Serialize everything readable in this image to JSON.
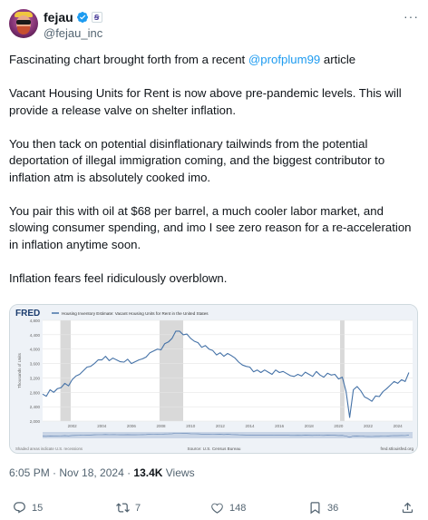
{
  "author": {
    "display_name": "fejau",
    "handle": "@fejau_inc",
    "affiliate_badge_glyph": "Ꞩ"
  },
  "more_label": "···",
  "text": {
    "p1_before": "Fascinating chart brought forth from a recent ",
    "p1_mention": "@profplum99",
    "p1_after": " article",
    "p2": "Vacant Housing Units for Rent is now above pre-pandemic levels. This will provide a release valve on shelter inflation.",
    "p3": "You then tack on potential disinflationary tailwinds from the potential deportation of illegal immigration coming, and the biggest contributor to inflation atm is absolutely cooked imo.",
    "p4": "You pair this with oil at $68 per barrel, a much cooler labor market, and slowing consumer spending, and imo I see zero reason for a re-acceleration in inflation anytime soon.",
    "p5": "Inflation fears feel ridiculously overblown."
  },
  "chart_data": {
    "type": "line",
    "source_logo": "FRED",
    "title": "Housing Inventory Estimate: Vacant Housing Units for Rent in the United States",
    "ylabel": "Thousands of Units",
    "ylim": [
      2000,
      4800
    ],
    "yticks": [
      "4,800",
      "4,400",
      "4,000",
      "3,600",
      "3,200",
      "2,800",
      "2,400",
      "2,000"
    ],
    "xlim": [
      2000,
      2025
    ],
    "xticks": [
      "2002",
      "2004",
      "2006",
      "2008",
      "2010",
      "2012",
      "2014",
      "2016",
      "2018",
      "2020",
      "2022",
      "2024"
    ],
    "recessions": [
      [
        2001.2,
        2001.9
      ],
      [
        2007.9,
        2009.5
      ],
      [
        2020.1,
        2020.4
      ]
    ],
    "footer_left": "Shaded areas indicate U.S. recessions",
    "source": "Source: U.S. Census Bureau",
    "url": "fred.stlouisfed.org",
    "series": [
      {
        "x": [
          2000.0,
          2000.25,
          2000.5,
          2000.75,
          2001.0,
          2001.25,
          2001.5,
          2001.75,
          2002.0,
          2002.25,
          2002.5,
          2002.75,
          2003.0,
          2003.25,
          2003.5,
          2003.75,
          2004.0,
          2004.25,
          2004.5,
          2004.75,
          2005.0,
          2005.25,
          2005.5,
          2005.75,
          2006.0,
          2006.25,
          2006.5,
          2006.75,
          2007.0,
          2007.25,
          2007.5,
          2007.75,
          2008.0,
          2008.25,
          2008.5,
          2008.75,
          2009.0,
          2009.25,
          2009.5,
          2009.75,
          2010.0,
          2010.25,
          2010.5,
          2010.75,
          2011.0,
          2011.25,
          2011.5,
          2011.75,
          2012.0,
          2012.25,
          2012.5,
          2012.75,
          2013.0,
          2013.25,
          2013.5,
          2013.75,
          2014.0,
          2014.25,
          2014.5,
          2014.75,
          2015.0,
          2015.25,
          2015.5,
          2015.75,
          2016.0,
          2016.25,
          2016.5,
          2016.75,
          2017.0,
          2017.25,
          2017.5,
          2017.75,
          2018.0,
          2018.25,
          2018.5,
          2018.75,
          2019.0,
          2019.25,
          2019.5,
          2019.75,
          2020.0,
          2020.25,
          2020.5,
          2020.75,
          2021.0,
          2021.25,
          2021.5,
          2021.75,
          2022.0,
          2022.25,
          2022.5,
          2022.75,
          2023.0,
          2023.25,
          2023.5,
          2023.75,
          2024.0,
          2024.25,
          2024.5,
          2024.75
        ],
        "y": [
          2750,
          2690,
          2870,
          2800,
          2900,
          2930,
          3050,
          2980,
          3150,
          3250,
          3300,
          3400,
          3500,
          3520,
          3600,
          3700,
          3700,
          3800,
          3680,
          3750,
          3700,
          3650,
          3640,
          3720,
          3600,
          3650,
          3700,
          3730,
          3780,
          3900,
          3950,
          4000,
          3980,
          4150,
          4200,
          4300,
          4500,
          4500,
          4400,
          4420,
          4300,
          4220,
          4180,
          4050,
          4100,
          4000,
          3960,
          3840,
          3900,
          3800,
          3880,
          3820,
          3750,
          3640,
          3560,
          3520,
          3500,
          3370,
          3420,
          3350,
          3420,
          3360,
          3300,
          3420,
          3350,
          3380,
          3320,
          3260,
          3240,
          3300,
          3250,
          3360,
          3300,
          3240,
          3380,
          3280,
          3220,
          3330,
          3280,
          3300,
          3170,
          3220,
          2830,
          2100,
          2870,
          2960,
          2840,
          2670,
          2620,
          2550,
          2700,
          2680,
          2820,
          2900,
          3000,
          3100,
          3050,
          3150,
          3100,
          3350
        ]
      }
    ]
  },
  "meta": {
    "timestamp": "6:05 PM · Nov 18, 2024 · ",
    "views_count": "13.4K",
    "views_label": " Views"
  },
  "actions": {
    "replies": "15",
    "reposts": "7",
    "likes": "148",
    "bookmarks": "36"
  },
  "colors": {
    "accent": "#1d9bf0",
    "muted": "#536471",
    "line": "#4572a7",
    "recession": "#d9d9d9"
  }
}
